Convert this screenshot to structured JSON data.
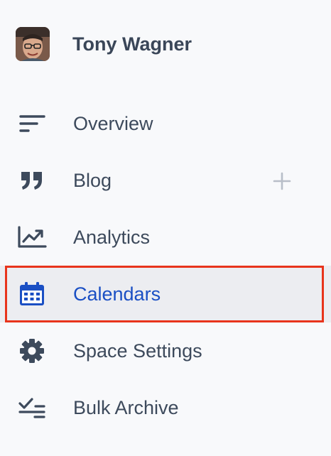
{
  "profile": {
    "name": "Tony Wagner"
  },
  "nav": {
    "items": [
      {
        "label": "Overview",
        "icon": "overview-icon"
      },
      {
        "label": "Blog",
        "icon": "quote-icon",
        "action": "plus-icon"
      },
      {
        "label": "Analytics",
        "icon": "analytics-chart-icon"
      },
      {
        "label": "Calendars",
        "icon": "calendar-icon",
        "active": true
      },
      {
        "label": "Space Settings",
        "icon": "gear-icon"
      },
      {
        "label": "Bulk Archive",
        "icon": "checklist-icon"
      }
    ]
  },
  "colors": {
    "text": "#3d4a5c",
    "active_text": "#1a4fc4",
    "active_bg": "#ecedf1",
    "highlight_border": "#e8341c",
    "background": "#f8f9fb"
  }
}
